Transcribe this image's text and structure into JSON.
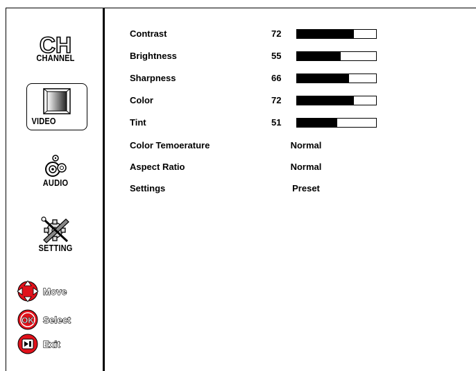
{
  "sidebar": {
    "channel": {
      "icon_text": "CH",
      "label": "CHANNEL"
    },
    "video": {
      "label": "VIDEO",
      "selected": true
    },
    "audio": {
      "label": "AUDIO"
    },
    "setting": {
      "label": "SETTING"
    }
  },
  "legend": {
    "move": "Move",
    "select": "Select",
    "ok_icon_text": "OK",
    "exit": "Exit"
  },
  "menu": {
    "contrast": {
      "label": "Contrast",
      "value": "72",
      "level": 0.72
    },
    "brightness": {
      "label": "Brightness",
      "value": "55",
      "level": 0.55
    },
    "sharpness": {
      "label": "Sharpness",
      "value": "66",
      "level": 0.66
    },
    "color": {
      "label": "Color",
      "value": "72",
      "level": 0.72
    },
    "tint": {
      "label": "Tint",
      "value": "51",
      "level": 0.51
    },
    "color_temperature": {
      "label": "Color Temoerature",
      "value": "Normal"
    },
    "aspect_ratio": {
      "label": "Aspect Ratio",
      "value": "Normal"
    },
    "settings": {
      "label": "Settings",
      "value": "Preset"
    }
  },
  "colors": {
    "accent_red": "#e0121b",
    "bar_fill": "#000000"
  }
}
